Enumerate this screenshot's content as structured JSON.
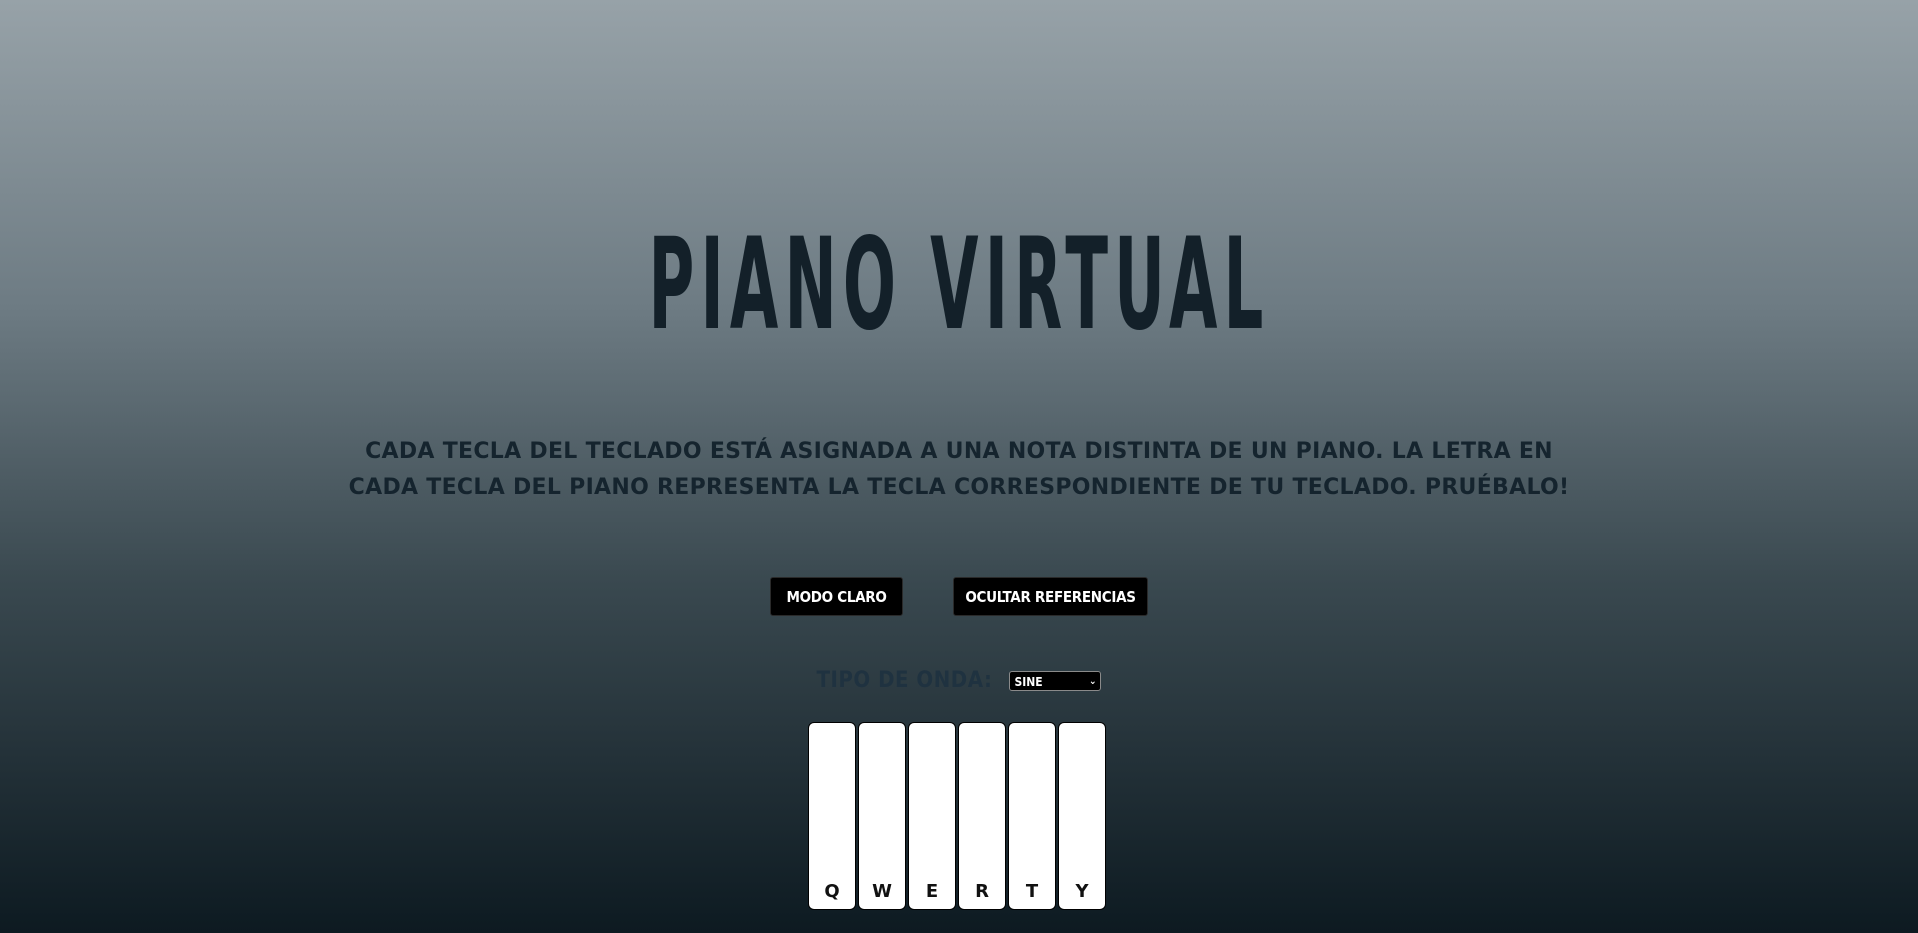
{
  "header": {
    "title": "Piano Virtual"
  },
  "description": "Cada tecla del teclado está asignada a una nota distinta de un piano. La letra en cada tecla del piano representa la tecla correspondiente de tu teclado. Pruébalo!",
  "controls": {
    "mode_label": "Modo claro",
    "refs_label": "Ocultar referencias"
  },
  "wave": {
    "label": "Tipo de onda:",
    "selected": "sine"
  },
  "keys": [
    {
      "letter": "Q"
    },
    {
      "letter": "W"
    },
    {
      "letter": "E"
    },
    {
      "letter": "R"
    },
    {
      "letter": "T"
    },
    {
      "letter": "Y"
    }
  ],
  "colors": {
    "background_top": "#97a2a8",
    "background_bottom": "#0d1a21",
    "text": "#15242e",
    "button_bg": "#000000",
    "button_text": "#ffffff",
    "key_bg": "#ffffff"
  }
}
